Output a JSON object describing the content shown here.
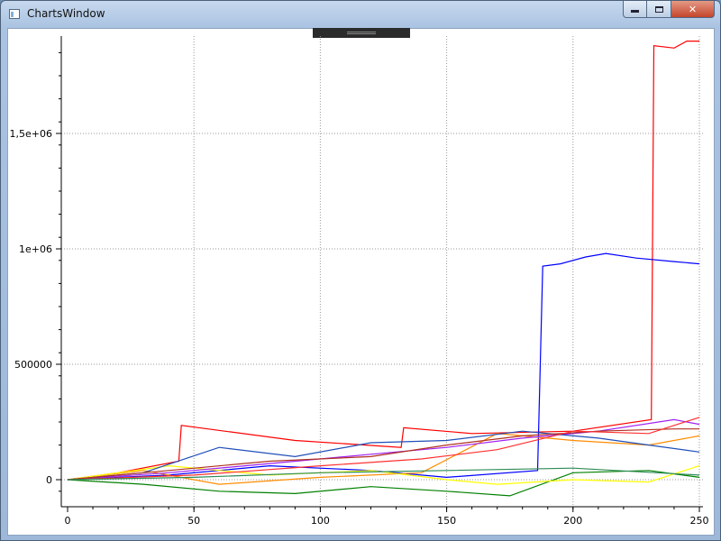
{
  "window": {
    "title": "ChartsWindow",
    "controls": [
      "minimize",
      "maximize",
      "close"
    ],
    "close_glyph": "✕"
  },
  "chart_data": {
    "type": "line",
    "title": "",
    "xlabel": "",
    "ylabel": "",
    "xlim": [
      0,
      250
    ],
    "ylim": [
      -80000,
      1900000
    ],
    "grid": true,
    "x_ticks": [
      0,
      50,
      100,
      150,
      200,
      250
    ],
    "x_tick_labels": [
      "0",
      "50",
      "100",
      "150",
      "200",
      "250"
    ],
    "y_ticks": [
      0,
      500000,
      1000000,
      1500000
    ],
    "y_tick_labels": [
      "0",
      "500000",
      "1e+06",
      "1,5e+06"
    ],
    "colors": [
      "#ff0000",
      "#0000ff",
      "#008000",
      "#ff8c00",
      "#ffff00",
      "#a020f0",
      "#1f4fb8",
      "#b03020",
      "#ff3030",
      "#2e8b57"
    ],
    "series": [
      {
        "color": "#ff0000",
        "x": [
          0,
          20,
          44,
          45,
          90,
          132,
          133,
          160,
          200,
          231,
          232,
          240,
          245,
          250
        ],
        "y": [
          0,
          30000,
          80000,
          235000,
          170000,
          140000,
          225000,
          200000,
          210000,
          260000,
          1880000,
          1870000,
          1900000,
          1900000
        ]
      },
      {
        "color": "#0000ff",
        "x": [
          0,
          40,
          80,
          120,
          150,
          186,
          188,
          195,
          205,
          213,
          225,
          240,
          250
        ],
        "y": [
          0,
          20000,
          60000,
          40000,
          10000,
          40000,
          925000,
          935000,
          965000,
          980000,
          960000,
          945000,
          935000
        ]
      },
      {
        "color": "#008000",
        "x": [
          0,
          30,
          60,
          90,
          120,
          150,
          175,
          200,
          230,
          250
        ],
        "y": [
          0,
          -20000,
          -50000,
          -60000,
          -30000,
          -50000,
          -70000,
          30000,
          40000,
          10000
        ]
      },
      {
        "color": "#ff8c00",
        "x": [
          0,
          30,
          60,
          100,
          140,
          170,
          200,
          230,
          250
        ],
        "y": [
          0,
          40000,
          -20000,
          10000,
          30000,
          200000,
          170000,
          150000,
          190000
        ]
      },
      {
        "color": "#ffff00",
        "x": [
          0,
          40,
          80,
          120,
          150,
          170,
          200,
          230,
          250
        ],
        "y": [
          0,
          60000,
          20000,
          40000,
          0,
          -20000,
          0,
          -10000,
          60000
        ]
      },
      {
        "color": "#a020f0",
        "x": [
          0,
          40,
          80,
          120,
          150,
          180,
          210,
          240,
          250
        ],
        "y": [
          0,
          30000,
          70000,
          110000,
          140000,
          180000,
          210000,
          260000,
          240000
        ]
      },
      {
        "color": "#1f4fb8",
        "x": [
          0,
          30,
          60,
          90,
          120,
          150,
          180,
          210,
          250
        ],
        "y": [
          0,
          30000,
          140000,
          100000,
          160000,
          170000,
          210000,
          180000,
          120000
        ]
      },
      {
        "color": "#b03020",
        "x": [
          0,
          40,
          80,
          120,
          150,
          180,
          210,
          240,
          250
        ],
        "y": [
          0,
          40000,
          80000,
          100000,
          150000,
          190000,
          210000,
          220000,
          220000
        ]
      },
      {
        "color": "#ff3030",
        "x": [
          0,
          50,
          100,
          140,
          170,
          200,
          230,
          250
        ],
        "y": [
          0,
          20000,
          60000,
          90000,
          130000,
          210000,
          200000,
          270000
        ]
      },
      {
        "color": "#2e8b57",
        "x": [
          0,
          50,
          100,
          150,
          200,
          250
        ],
        "y": [
          0,
          10000,
          30000,
          40000,
          50000,
          20000
        ]
      }
    ]
  }
}
